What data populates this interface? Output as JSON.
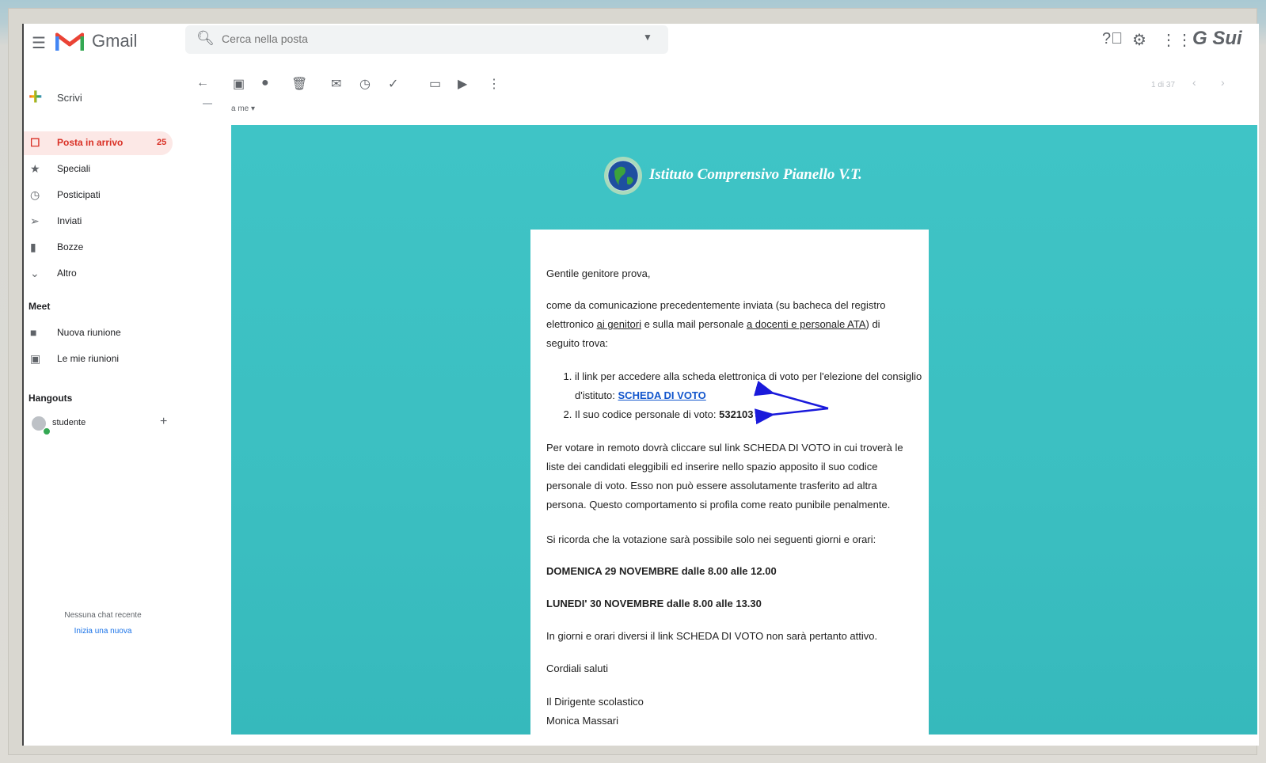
{
  "app": {
    "name": "Gmail",
    "brand": "G Sui"
  },
  "search": {
    "placeholder": "Cerca nella posta"
  },
  "sidebar": {
    "compose_label": "Scrivi",
    "items": [
      {
        "label": "Posta in arrivo",
        "count": "25",
        "icon": "inbox-icon"
      },
      {
        "label": "Speciali",
        "icon": "star-icon"
      },
      {
        "label": "Posticipati",
        "icon": "clock-icon"
      },
      {
        "label": "Inviati",
        "icon": "send-icon"
      },
      {
        "label": "Bozze",
        "icon": "draft-icon"
      },
      {
        "label": "Altro",
        "icon": "chevron-down-icon"
      }
    ],
    "meet": {
      "title": "Meet",
      "items": [
        {
          "label": "Nuova riunione",
          "icon": "video-icon"
        },
        {
          "label": "Le mie riunioni",
          "icon": "calendar-icon"
        }
      ]
    },
    "hangouts": {
      "title": "Hangouts",
      "user": "studente",
      "no_chat": "Nessuna chat recente",
      "start_chat": "Inizia una nuova"
    }
  },
  "toolbar": {
    "pager": "1 di 37"
  },
  "message": {
    "to": "a me"
  },
  "email": {
    "school_name": "Istituto Comprensivo Pianello V.T.",
    "greeting": "Gentile genitore prova,",
    "intro_1": "come da comunicazione precedentemente inviata (su bacheca del registro elettronico ",
    "intro_link_1": "ai genitori",
    "intro_2": " e sulla mail personale ",
    "intro_link_2": "a docenti e personale ATA",
    "intro_3": ") di seguito trova:",
    "list_1": "il link per accedere alla scheda elettronica di voto per l'elezione del consiglio d'istituto: ",
    "list_1_link": "SCHEDA DI VOTO",
    "list_2": "Il suo codice personale di voto: ",
    "list_2_code": "532103",
    "para_remote": "Per votare in remoto dovrà cliccare sul link SCHEDA DI VOTO in cui troverà le liste dei candidati eleggibili ed inserire nello spazio apposito il suo codice personale di voto. Esso non può essere assolutamente trasferito ad altra persona. Questo comportamento si profila come reato punibile penalmente.",
    "para_reminder": "Si ricorda che la votazione sarà possibile solo nei seguenti giorni e orari:",
    "day_1": "DOMENICA 29 NOVEMBRE  dalle 8.00 alle 12.00",
    "day_2": "LUNEDI' 30 NOVEMBRE dalle 8.00 alle 13.30",
    "para_inactive": "In giorni e orari diversi il link SCHEDA DI VOTO non sarà pertanto attivo.",
    "closing": "Cordiali saluti",
    "signature_title": "Il Dirigente scolastico",
    "signature_name": "Monica Massari"
  },
  "colors": {
    "email_background": "#3fc4c6",
    "active_nav": "#d93025",
    "annotation_arrow": "#1a1adb"
  }
}
